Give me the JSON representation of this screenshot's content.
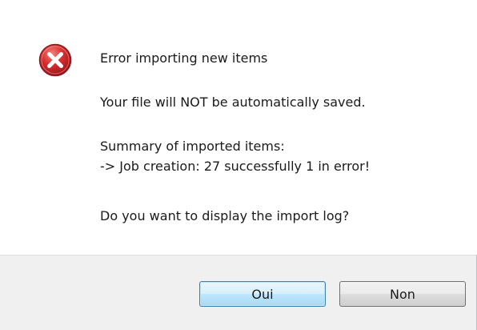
{
  "dialog": {
    "icon": "error-icon",
    "title_message": "Error importing new items",
    "warning": "Your file will NOT be automatically saved.",
    "summary_heading": "Summary of imported items:",
    "summary_detail": "-> Job creation: 27 successfully 1 in error!",
    "question": "Do you want to display the import log?"
  },
  "buttons": {
    "yes_label": "Oui",
    "no_label": "Non"
  },
  "colors": {
    "error_red": "#c8202a",
    "default_button_border": "#3c7fb1",
    "footer_background": "#f0f0f0"
  }
}
